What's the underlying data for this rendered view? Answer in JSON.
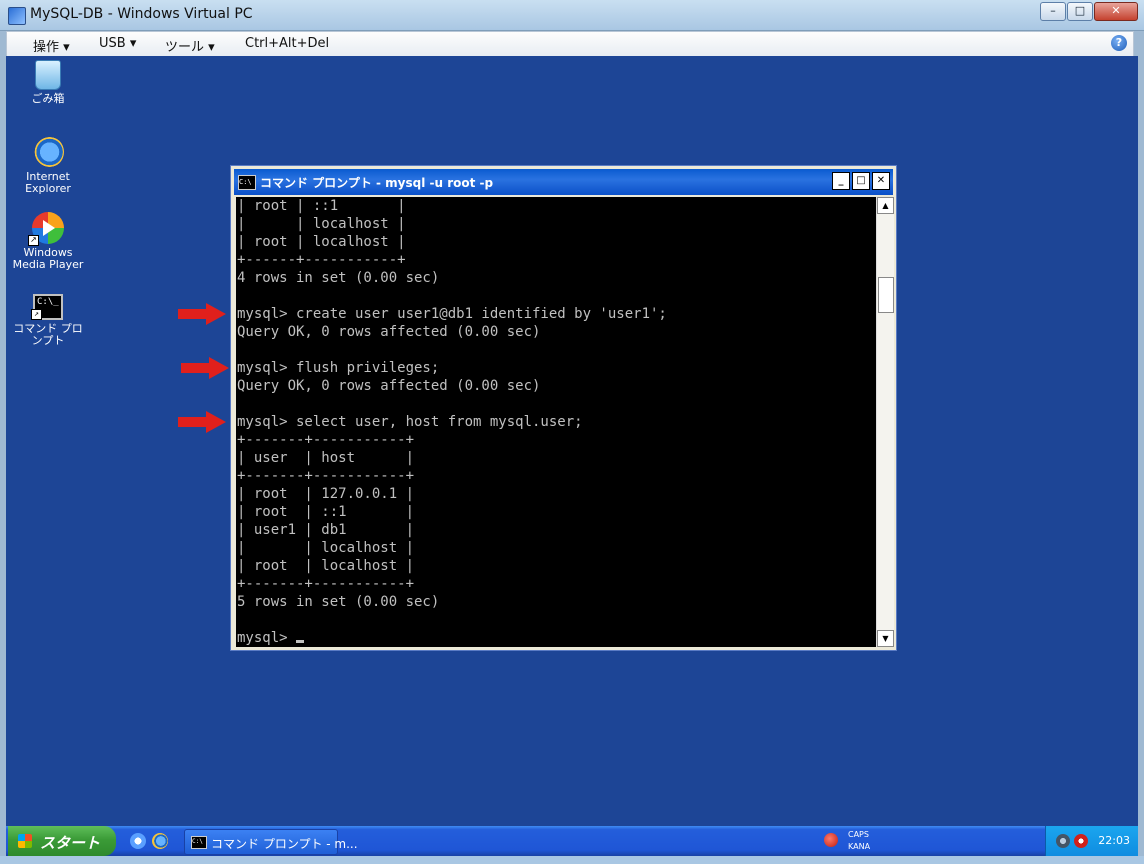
{
  "host": {
    "title": "MySQL-DB - Windows Virtual PC",
    "menu": [
      "操作 ▾",
      "USB ▾",
      "ツール ▾",
      "Ctrl+Alt+Del"
    ],
    "help_glyph": "?"
  },
  "desktop_icons": [
    {
      "label": "ごみ箱",
      "icon": "recycle-bin-icon"
    },
    {
      "label": "Internet Explorer",
      "icon": "internet-explorer-icon"
    },
    {
      "label": "Windows Media Player",
      "icon": "media-player-icon"
    },
    {
      "label": "コマンド プロンプト",
      "icon": "command-prompt-icon"
    }
  ],
  "cmd_window": {
    "title": "コマンド プロンプト - mysql -u root -p",
    "lines": [
      "| root | ::1       |",
      "|      | localhost |",
      "| root | localhost |",
      "+------+-----------+",
      "4 rows in set (0.00 sec)",
      "",
      "mysql> create user user1@db1 identified by 'user1';",
      "Query OK, 0 rows affected (0.00 sec)",
      "",
      "mysql> flush privileges;",
      "Query OK, 0 rows affected (0.00 sec)",
      "",
      "mysql> select user, host from mysql.user;",
      "+-------+-----------+",
      "| user  | host      |",
      "+-------+-----------+",
      "| root  | 127.0.0.1 |",
      "| root  | ::1       |",
      "| user1 | db1       |",
      "|       | localhost |",
      "| root  | localhost |",
      "+-------+-----------+",
      "5 rows in set (0.00 sec)",
      "",
      "mysql> "
    ]
  },
  "taskbar": {
    "start_label": "スタート",
    "task_label": "コマンド プロンプト - m...",
    "caps": "CAPS",
    "kana": "KANA",
    "clock": "22:03"
  },
  "colors": {
    "desktop": "#1d4596",
    "console_bg": "#000000",
    "console_fg": "#c0c0c0",
    "arrow": "#e0201c"
  }
}
